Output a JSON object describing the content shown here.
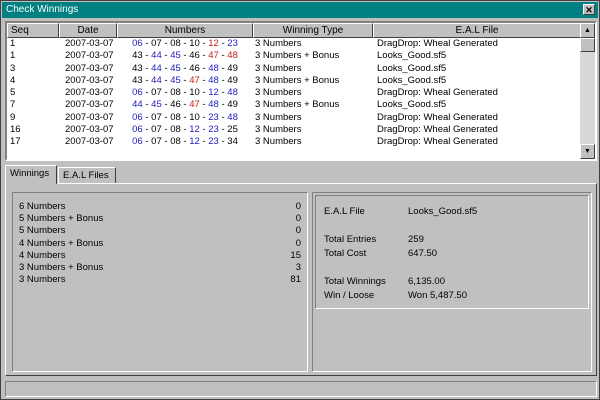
{
  "window": {
    "title": "Check Winnings"
  },
  "grid": {
    "headers": [
      "Seq",
      "Date",
      "Numbers",
      "Winning Type",
      "E.A.L File"
    ],
    "rows": [
      {
        "seq": "1",
        "date": "2007-03-07",
        "numbers": [
          [
            "06",
            "blue"
          ],
          [
            "07",
            "black"
          ],
          [
            "08",
            "black"
          ],
          [
            "10",
            "black"
          ],
          [
            "12",
            "red"
          ],
          [
            "23",
            "blue"
          ]
        ],
        "type": "3 Numbers",
        "file": "DragDrop: Wheal Generated"
      },
      {
        "seq": "1",
        "date": "2007-03-07",
        "numbers": [
          [
            "43",
            "black"
          ],
          [
            "44",
            "blue"
          ],
          [
            "45",
            "blue"
          ],
          [
            "46",
            "black"
          ],
          [
            "47",
            "red"
          ],
          [
            "48",
            "red"
          ]
        ],
        "type": "3 Numbers + Bonus",
        "file": "Looks_Good.sf5"
      },
      {
        "seq": "3",
        "date": "2007-03-07",
        "numbers": [
          [
            "43",
            "black"
          ],
          [
            "44",
            "blue"
          ],
          [
            "45",
            "blue"
          ],
          [
            "46",
            "black"
          ],
          [
            "48",
            "blue"
          ],
          [
            "49",
            "black"
          ]
        ],
        "type": "3 Numbers",
        "file": "Looks_Good.sf5"
      },
      {
        "seq": "4",
        "date": "2007-03-07",
        "numbers": [
          [
            "43",
            "black"
          ],
          [
            "44",
            "blue"
          ],
          [
            "45",
            "blue"
          ],
          [
            "47",
            "red"
          ],
          [
            "48",
            "blue"
          ],
          [
            "49",
            "black"
          ]
        ],
        "type": "3 Numbers + Bonus",
        "file": "Looks_Good.sf5"
      },
      {
        "seq": "5",
        "date": "2007-03-07",
        "numbers": [
          [
            "06",
            "blue"
          ],
          [
            "07",
            "black"
          ],
          [
            "08",
            "black"
          ],
          [
            "10",
            "black"
          ],
          [
            "12",
            "blue"
          ],
          [
            "48",
            "blue"
          ]
        ],
        "type": "3 Numbers",
        "file": "DragDrop: Wheal Generated"
      },
      {
        "seq": "7",
        "date": "2007-03-07",
        "numbers": [
          [
            "44",
            "blue"
          ],
          [
            "45",
            "blue"
          ],
          [
            "46",
            "black"
          ],
          [
            "47",
            "red"
          ],
          [
            "48",
            "blue"
          ],
          [
            "49",
            "black"
          ]
        ],
        "type": "3 Numbers + Bonus",
        "file": "Looks_Good.sf5"
      },
      {
        "seq": "9",
        "date": "2007-03-07",
        "numbers": [
          [
            "06",
            "blue"
          ],
          [
            "07",
            "black"
          ],
          [
            "08",
            "black"
          ],
          [
            "10",
            "black"
          ],
          [
            "23",
            "blue"
          ],
          [
            "48",
            "blue"
          ]
        ],
        "type": "3 Numbers",
        "file": "DragDrop: Wheal Generated"
      },
      {
        "seq": "16",
        "date": "2007-03-07",
        "numbers": [
          [
            "06",
            "blue"
          ],
          [
            "07",
            "black"
          ],
          [
            "08",
            "black"
          ],
          [
            "12",
            "blue"
          ],
          [
            "23",
            "blue"
          ],
          [
            "25",
            "black"
          ]
        ],
        "type": "3 Numbers",
        "file": "DragDrop: Wheal Generated"
      },
      {
        "seq": "17",
        "date": "2007-03-07",
        "numbers": [
          [
            "06",
            "blue"
          ],
          [
            "07",
            "black"
          ],
          [
            "08",
            "black"
          ],
          [
            "12",
            "blue"
          ],
          [
            "23",
            "blue"
          ],
          [
            "34",
            "black"
          ]
        ],
        "type": "3 Numbers",
        "file": "DragDrop: Wheal Generated"
      }
    ]
  },
  "tabs": [
    {
      "label": "Winnings",
      "active": true
    },
    {
      "label": "E.A.L Files",
      "active": false
    }
  ],
  "winnings_stats": [
    {
      "label": "6 Numbers",
      "value": "0"
    },
    {
      "label": "5 Numbers + Bonus",
      "value": "0"
    },
    {
      "label": "5 Numbers",
      "value": "0"
    },
    {
      "label": "4 Numbers + Bonus",
      "value": "0"
    },
    {
      "label": "4 Numbers",
      "value": "15"
    },
    {
      "label": "3 Numbers + Bonus",
      "value": "3"
    },
    {
      "label": "3 Numbers",
      "value": "81"
    }
  ],
  "summary": {
    "eal_file_label": "E.A.L File",
    "eal_file_value": "Looks_Good.sf5",
    "total_entries_label": "Total Entries",
    "total_entries_value": "259",
    "total_cost_label": "Total Cost",
    "total_cost_value": "647.50",
    "total_winnings_label": "Total Winnings",
    "total_winnings_value": "6,135.00",
    "win_loose_label": "Win / Loose",
    "win_loose_value": "Won 5,487.50"
  },
  "colors": {
    "titlebar": "#008080",
    "number_blue": "#2020c0",
    "number_red": "#c02020"
  },
  "icons": {
    "close": "close-icon",
    "scroll_up": "arrow-up-icon",
    "scroll_down": "arrow-down-icon"
  }
}
